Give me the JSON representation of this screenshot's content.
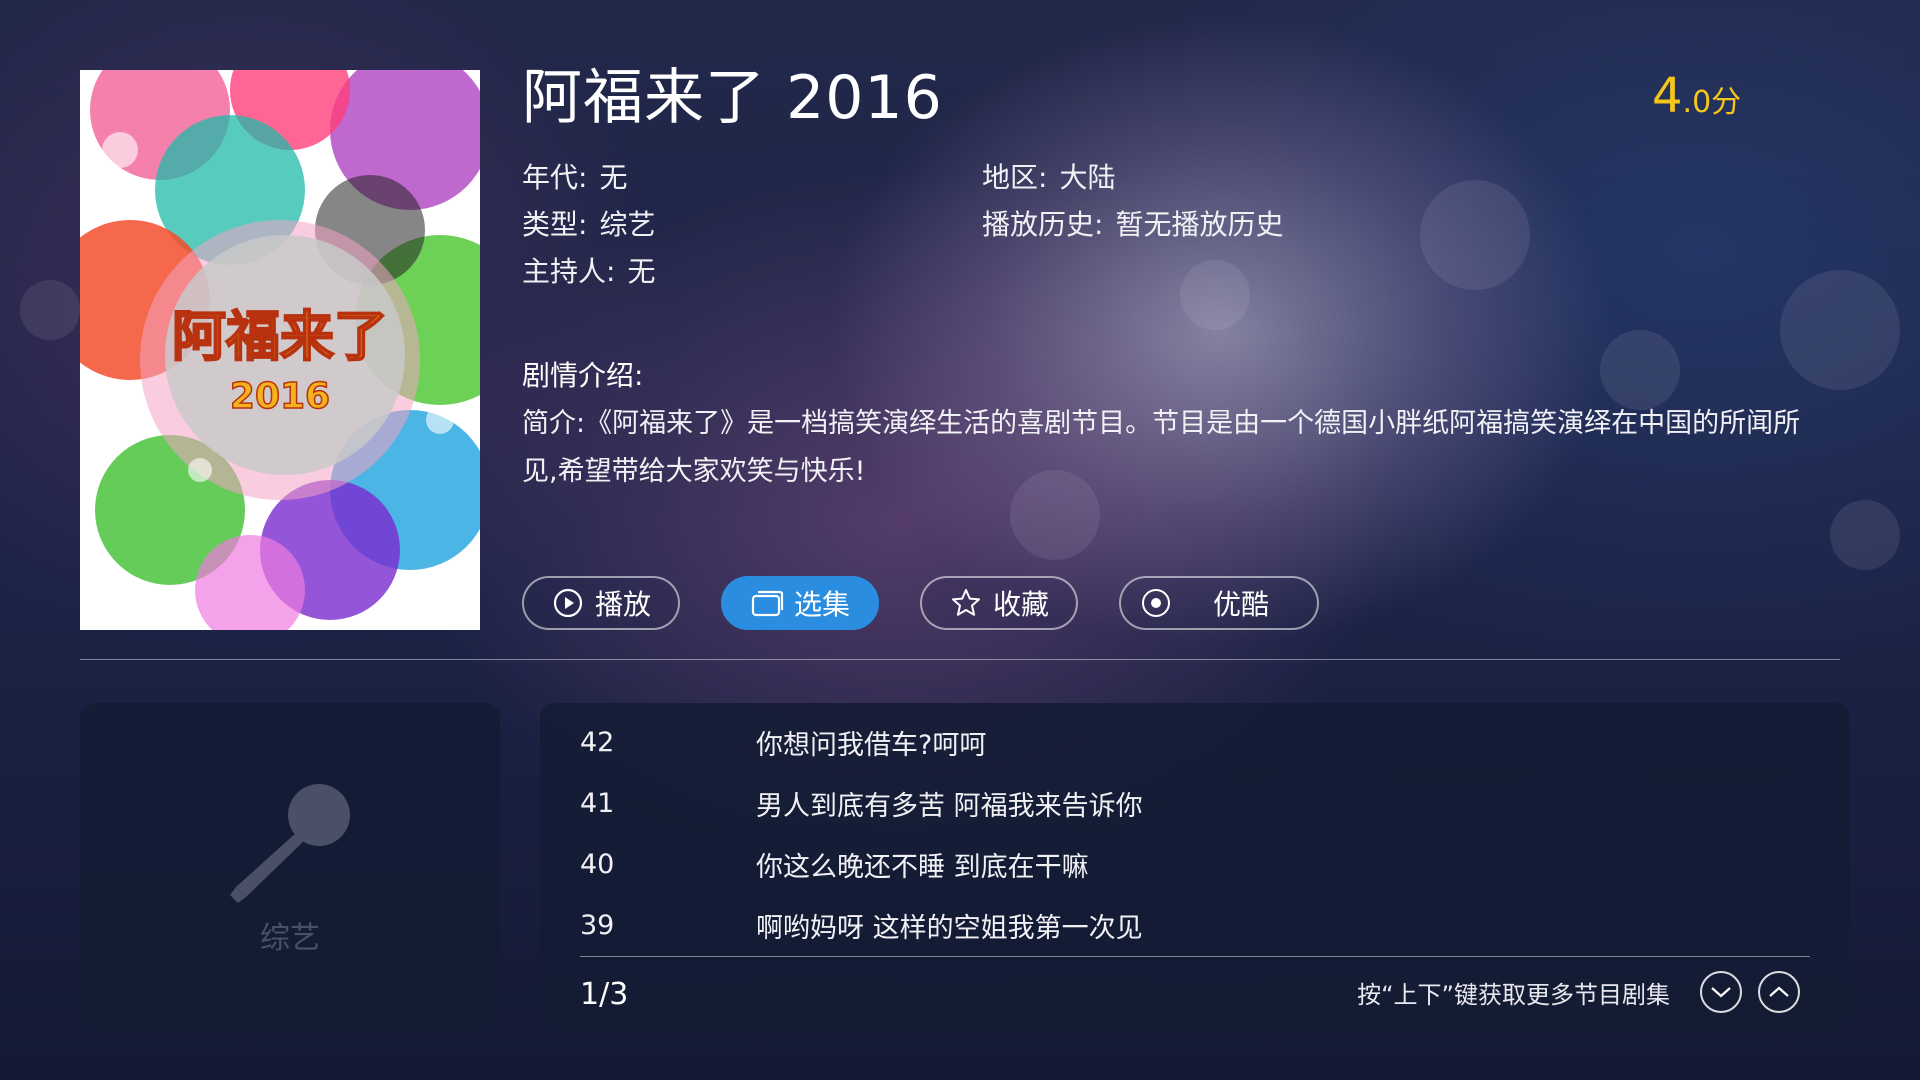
{
  "show": {
    "title": "阿福来了 2016",
    "score_main": "4",
    "score_sub": ".0分",
    "poster_text_line1": "阿福来了",
    "poster_text_line2": "2016"
  },
  "meta": {
    "era_label": "年代:",
    "era_value": "无",
    "region_label": "地区:",
    "region_value": "大陆",
    "genre_label": "类型:",
    "genre_value": "综艺",
    "history_label": "播放历史:",
    "history_value": "暂无播放历史",
    "host_label": "主持人:",
    "host_value": "无"
  },
  "description": {
    "heading": "剧情介绍:",
    "body": "简介:《阿福来了》是一档搞笑演绎生活的喜剧节目。节目是由一个德国小胖纸阿福搞笑演绎在中国的所闻所见,希望带给大家欢笑与快乐!"
  },
  "actions": {
    "play_label": "播放",
    "episodes_label": "选集",
    "favorite_label": "收藏",
    "source_label": "优酷"
  },
  "category": {
    "label": "综艺",
    "icon": "microphone-icon"
  },
  "episodes": [
    {
      "num": "42",
      "title": "你想问我借车?呵呵"
    },
    {
      "num": "41",
      "title": "男人到底有多苦 阿福我来告诉你"
    },
    {
      "num": "40",
      "title": "你这么晚还不睡 到底在干嘛"
    },
    {
      "num": "39",
      "title": "啊哟妈呀 这样的空姐我第一次见"
    }
  ],
  "pager": {
    "page": "1/3",
    "hint": "按“上下”键获取更多节目剧集"
  },
  "colors": {
    "accent": "#2a8de0",
    "score": "#f5c61a",
    "panel": "#141c34"
  }
}
